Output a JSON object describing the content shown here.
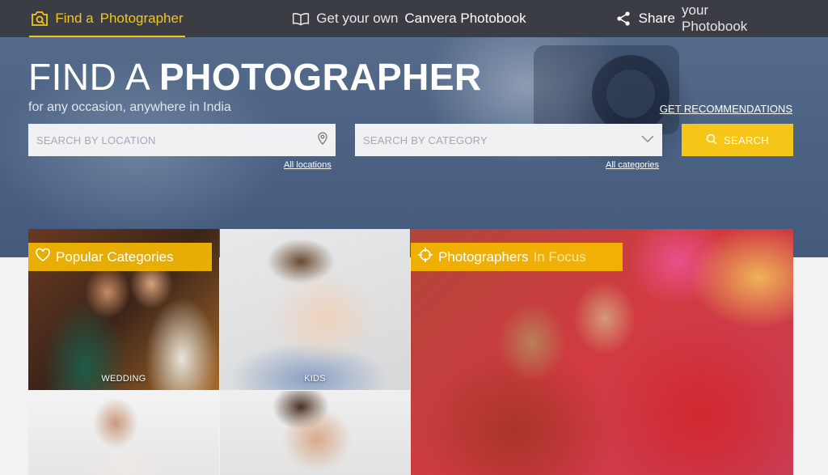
{
  "nav": {
    "find_prefix": "Find a",
    "find_strong": "Photographer",
    "photobook_prefix": "Get your own",
    "photobook_strong": "Canvera Photobook",
    "share_strong": "Share",
    "share_suffix": "your Photobook"
  },
  "hero": {
    "title_light": "FIND A",
    "title_bold": "PHOTOGRAPHER",
    "subtitle": "for any occasion, anywhere in India",
    "get_recommendations": "GET RECOMMENDATIONS",
    "location_placeholder": "SEARCH BY LOCATION",
    "category_placeholder": "SEARCH BY CATEGORY",
    "search_label": "SEARCH",
    "all_locations": "All locations",
    "all_categories": "All categories"
  },
  "grid": {
    "popular_label": "Popular Categories",
    "focus_prefix": "Photographers",
    "focus_suffix": "In Focus",
    "tiles": [
      {
        "label": "WEDDING"
      },
      {
        "label": "KIDS"
      }
    ]
  },
  "colors": {
    "accent": "#f5c518",
    "nav_bg": "#3a3d44"
  }
}
